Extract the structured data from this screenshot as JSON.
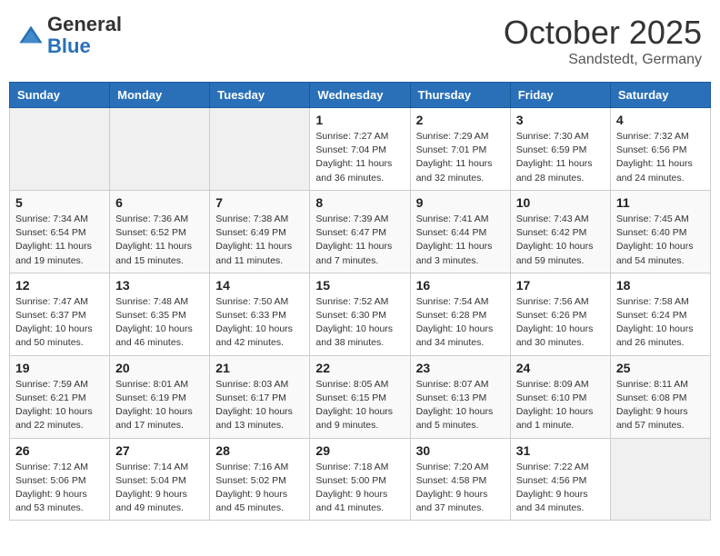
{
  "logo": {
    "general": "General",
    "blue": "Blue"
  },
  "header": {
    "month": "October 2025",
    "location": "Sandstedt, Germany"
  },
  "weekdays": [
    "Sunday",
    "Monday",
    "Tuesday",
    "Wednesday",
    "Thursday",
    "Friday",
    "Saturday"
  ],
  "weeks": [
    [
      {
        "day": "",
        "info": ""
      },
      {
        "day": "",
        "info": ""
      },
      {
        "day": "",
        "info": ""
      },
      {
        "day": "1",
        "info": "Sunrise: 7:27 AM\nSunset: 7:04 PM\nDaylight: 11 hours\nand 36 minutes."
      },
      {
        "day": "2",
        "info": "Sunrise: 7:29 AM\nSunset: 7:01 PM\nDaylight: 11 hours\nand 32 minutes."
      },
      {
        "day": "3",
        "info": "Sunrise: 7:30 AM\nSunset: 6:59 PM\nDaylight: 11 hours\nand 28 minutes."
      },
      {
        "day": "4",
        "info": "Sunrise: 7:32 AM\nSunset: 6:56 PM\nDaylight: 11 hours\nand 24 minutes."
      }
    ],
    [
      {
        "day": "5",
        "info": "Sunrise: 7:34 AM\nSunset: 6:54 PM\nDaylight: 11 hours\nand 19 minutes."
      },
      {
        "day": "6",
        "info": "Sunrise: 7:36 AM\nSunset: 6:52 PM\nDaylight: 11 hours\nand 15 minutes."
      },
      {
        "day": "7",
        "info": "Sunrise: 7:38 AM\nSunset: 6:49 PM\nDaylight: 11 hours\nand 11 minutes."
      },
      {
        "day": "8",
        "info": "Sunrise: 7:39 AM\nSunset: 6:47 PM\nDaylight: 11 hours\nand 7 minutes."
      },
      {
        "day": "9",
        "info": "Sunrise: 7:41 AM\nSunset: 6:44 PM\nDaylight: 11 hours\nand 3 minutes."
      },
      {
        "day": "10",
        "info": "Sunrise: 7:43 AM\nSunset: 6:42 PM\nDaylight: 10 hours\nand 59 minutes."
      },
      {
        "day": "11",
        "info": "Sunrise: 7:45 AM\nSunset: 6:40 PM\nDaylight: 10 hours\nand 54 minutes."
      }
    ],
    [
      {
        "day": "12",
        "info": "Sunrise: 7:47 AM\nSunset: 6:37 PM\nDaylight: 10 hours\nand 50 minutes."
      },
      {
        "day": "13",
        "info": "Sunrise: 7:48 AM\nSunset: 6:35 PM\nDaylight: 10 hours\nand 46 minutes."
      },
      {
        "day": "14",
        "info": "Sunrise: 7:50 AM\nSunset: 6:33 PM\nDaylight: 10 hours\nand 42 minutes."
      },
      {
        "day": "15",
        "info": "Sunrise: 7:52 AM\nSunset: 6:30 PM\nDaylight: 10 hours\nand 38 minutes."
      },
      {
        "day": "16",
        "info": "Sunrise: 7:54 AM\nSunset: 6:28 PM\nDaylight: 10 hours\nand 34 minutes."
      },
      {
        "day": "17",
        "info": "Sunrise: 7:56 AM\nSunset: 6:26 PM\nDaylight: 10 hours\nand 30 minutes."
      },
      {
        "day": "18",
        "info": "Sunrise: 7:58 AM\nSunset: 6:24 PM\nDaylight: 10 hours\nand 26 minutes."
      }
    ],
    [
      {
        "day": "19",
        "info": "Sunrise: 7:59 AM\nSunset: 6:21 PM\nDaylight: 10 hours\nand 22 minutes."
      },
      {
        "day": "20",
        "info": "Sunrise: 8:01 AM\nSunset: 6:19 PM\nDaylight: 10 hours\nand 17 minutes."
      },
      {
        "day": "21",
        "info": "Sunrise: 8:03 AM\nSunset: 6:17 PM\nDaylight: 10 hours\nand 13 minutes."
      },
      {
        "day": "22",
        "info": "Sunrise: 8:05 AM\nSunset: 6:15 PM\nDaylight: 10 hours\nand 9 minutes."
      },
      {
        "day": "23",
        "info": "Sunrise: 8:07 AM\nSunset: 6:13 PM\nDaylight: 10 hours\nand 5 minutes."
      },
      {
        "day": "24",
        "info": "Sunrise: 8:09 AM\nSunset: 6:10 PM\nDaylight: 10 hours\nand 1 minute."
      },
      {
        "day": "25",
        "info": "Sunrise: 8:11 AM\nSunset: 6:08 PM\nDaylight: 9 hours\nand 57 minutes."
      }
    ],
    [
      {
        "day": "26",
        "info": "Sunrise: 7:12 AM\nSunset: 5:06 PM\nDaylight: 9 hours\nand 53 minutes."
      },
      {
        "day": "27",
        "info": "Sunrise: 7:14 AM\nSunset: 5:04 PM\nDaylight: 9 hours\nand 49 minutes."
      },
      {
        "day": "28",
        "info": "Sunrise: 7:16 AM\nSunset: 5:02 PM\nDaylight: 9 hours\nand 45 minutes."
      },
      {
        "day": "29",
        "info": "Sunrise: 7:18 AM\nSunset: 5:00 PM\nDaylight: 9 hours\nand 41 minutes."
      },
      {
        "day": "30",
        "info": "Sunrise: 7:20 AM\nSunset: 4:58 PM\nDaylight: 9 hours\nand 37 minutes."
      },
      {
        "day": "31",
        "info": "Sunrise: 7:22 AM\nSunset: 4:56 PM\nDaylight: 9 hours\nand 34 minutes."
      },
      {
        "day": "",
        "info": ""
      }
    ]
  ]
}
